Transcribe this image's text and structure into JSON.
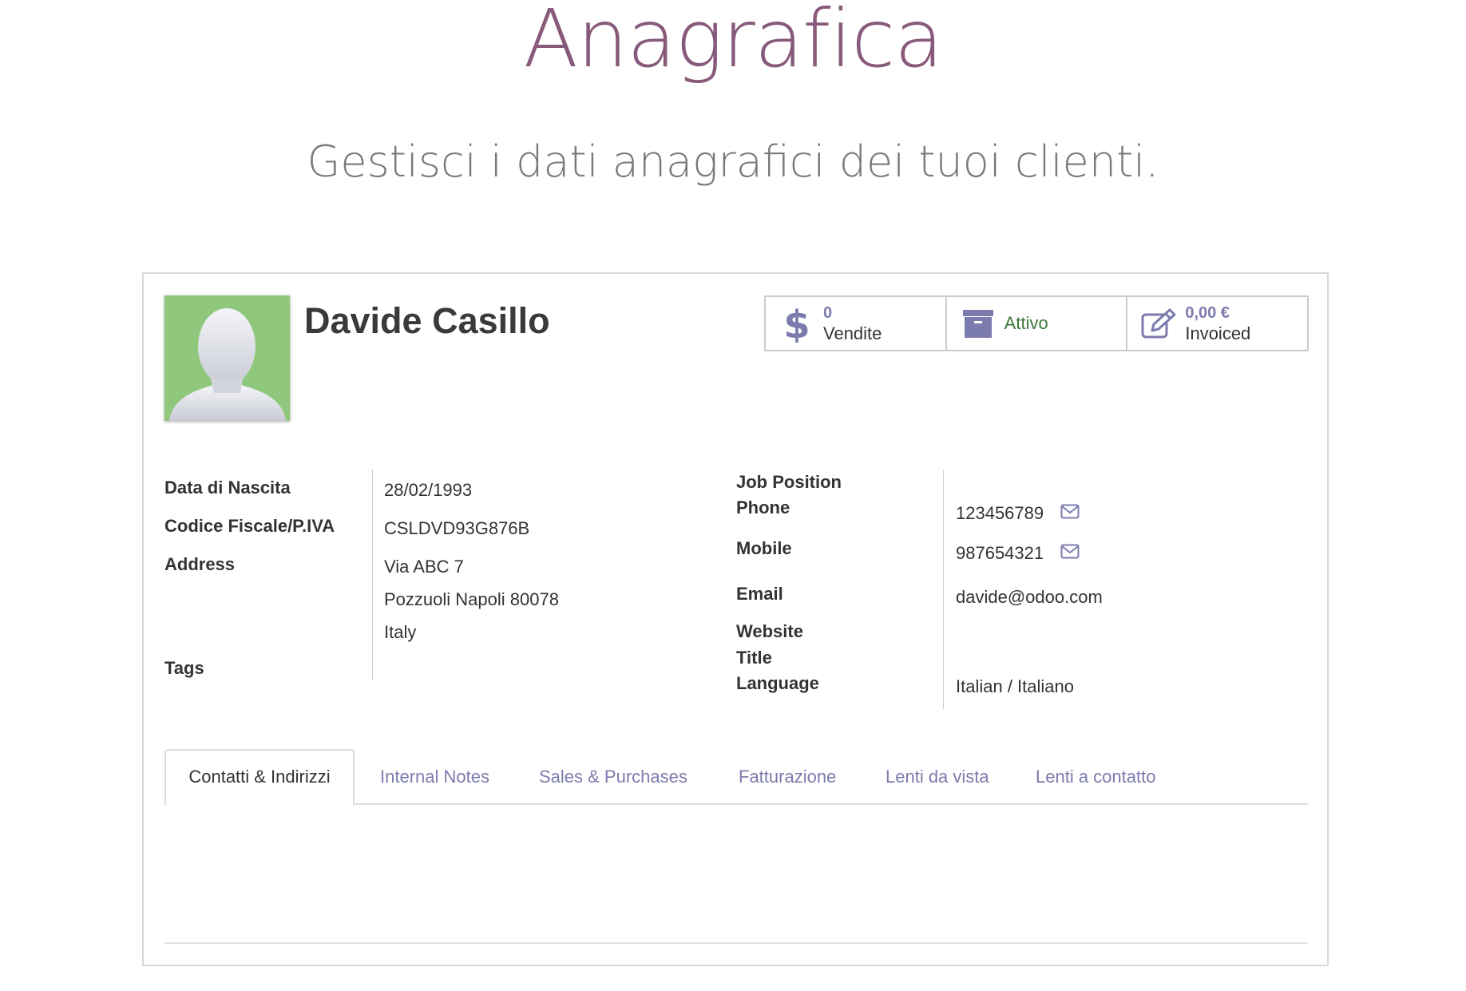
{
  "hero": {
    "title": "Anagrafica",
    "subtitle": "Gestisci i dati anagrafici dei tuoi clienti."
  },
  "partner": {
    "name": "Davide Casillo",
    "avatar_icon": "user-placeholder-icon",
    "avatar_bg": "#8fc77c"
  },
  "stats": [
    {
      "icon": "dollar-icon",
      "value": "0",
      "label": "Vendite"
    },
    {
      "icon": "archive-icon",
      "value": "",
      "label": "Attivo"
    },
    {
      "icon": "edit-icon",
      "value": "0,00 €",
      "label": "Invoiced"
    }
  ],
  "left_fields": {
    "birth_label": "Data di Nascita",
    "birth_value": "28/02/1993",
    "tax_label": "Codice Fiscale/P.IVA",
    "tax_value": "CSLDVD93G876B",
    "address_label": "Address",
    "address_line1": "Via ABC 7",
    "address_line2": "Pozzuoli Napoli 80078",
    "address_line3": "Italy",
    "tags_label": "Tags"
  },
  "right_fields": {
    "job_label": "Job Position",
    "phone_label": "Phone",
    "phone_value": "123456789",
    "mobile_label": "Mobile",
    "mobile_value": "987654321",
    "email_label": "Email",
    "email_value": "davide@odoo.com",
    "website_label": "Website",
    "title_label": "Title",
    "language_label": "Language",
    "language_value": "Italian / Italiano"
  },
  "tabs": [
    {
      "label": "Contatti & Indirizzi",
      "active": true
    },
    {
      "label": "Internal Notes",
      "active": false
    },
    {
      "label": "Sales & Purchases",
      "active": false
    },
    {
      "label": "Fatturazione",
      "active": false
    },
    {
      "label": "Lenti da vista",
      "active": false
    },
    {
      "label": "Lenti a contatto",
      "active": false
    }
  ],
  "colors": {
    "brand": "#875a7b",
    "accent": "#7c7bad",
    "status_green": "#3b7a3b"
  }
}
